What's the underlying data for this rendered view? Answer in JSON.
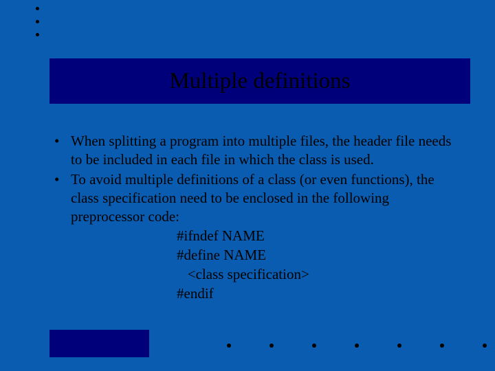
{
  "title": "Multiple definitions",
  "bullets": [
    "When splitting a program into multiple files, the header file needs to be included in each file in which the class is used.",
    "To avoid multiple definitions of a class (or even functions), the class specification need to be enclosed in the following preprocessor code:"
  ],
  "code": {
    "l1": "#ifndef NAME",
    "l2": "#define NAME",
    "l3": "   <class specification>",
    "l4": "#endif"
  },
  "marker": "•"
}
